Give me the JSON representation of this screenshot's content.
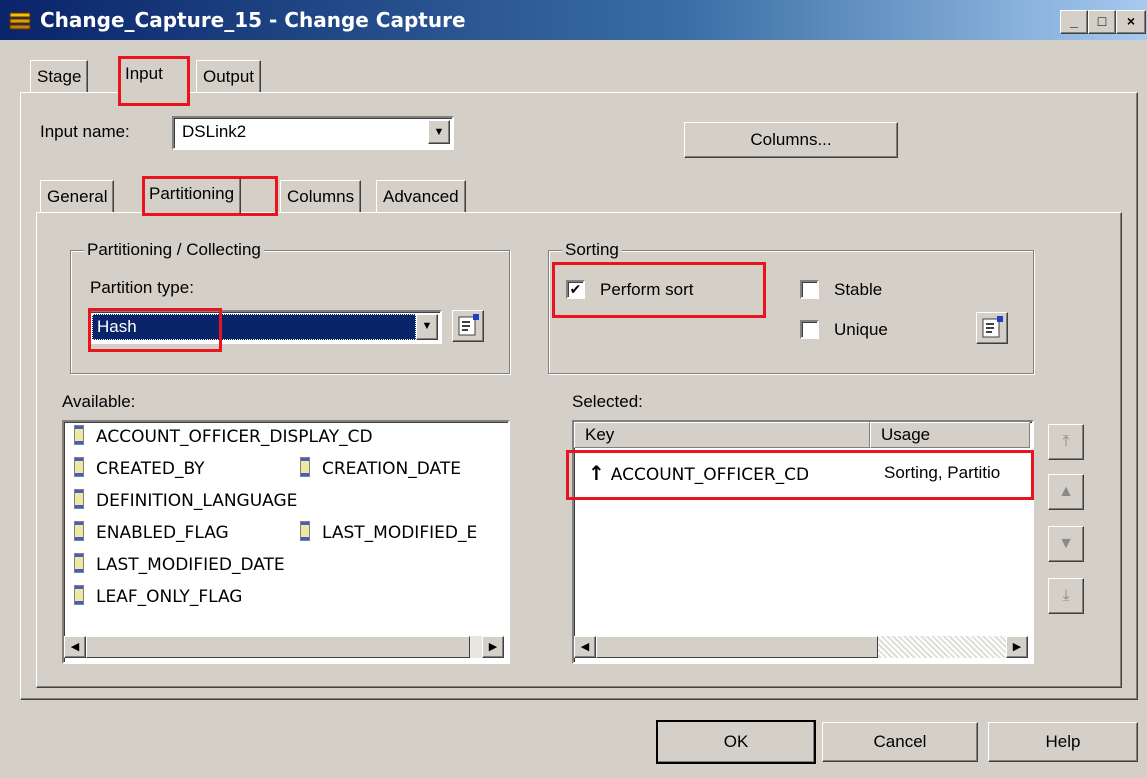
{
  "window": {
    "title": "Change_Capture_15 - Change Capture",
    "minimize": "_",
    "maximize": "□",
    "close": "×"
  },
  "top_tabs": [
    {
      "label": "Stage",
      "active": false
    },
    {
      "label": "Input",
      "active": true
    },
    {
      "label": "Output",
      "active": false
    }
  ],
  "input_name": {
    "label": "Input name:",
    "value": "DSLink2"
  },
  "columns_button": "Columns...",
  "sub_tabs": [
    {
      "label": "General",
      "active": false
    },
    {
      "label": "Partitioning",
      "active": true
    },
    {
      "label": "Columns",
      "active": false
    },
    {
      "label": "Advanced",
      "active": false
    }
  ],
  "partitioning": {
    "group_title": "Partitioning / Collecting",
    "type_label": "Partition type:",
    "type_value": "Hash"
  },
  "sorting": {
    "group_title": "Sorting",
    "perform_sort": {
      "label": "Perform sort",
      "checked": true
    },
    "stable": {
      "label": "Stable",
      "checked": false
    },
    "unique": {
      "label": "Unique",
      "checked": false
    }
  },
  "available": {
    "label": "Available:",
    "items": [
      "ACCOUNT_OFFICER_DISPLAY_CD",
      "CREATED_BY",
      "CREATION_DATE",
      "DEFINITION_LANGUAGE",
      "ENABLED_FLAG",
      "LAST_MODIFIED_E",
      "LAST_MODIFIED_DATE",
      "LEAF_ONLY_FLAG"
    ]
  },
  "selected": {
    "label": "Selected:",
    "headers": {
      "key": "Key",
      "usage": "Usage"
    },
    "rows": [
      {
        "key": "ACCOUNT_OFFICER_CD",
        "usage": "Sorting, Partitio",
        "sort_arrow": "↑"
      }
    ]
  },
  "buttons": {
    "ok": "OK",
    "cancel": "Cancel",
    "help": "Help"
  },
  "icons": {
    "scroll_left": "◀",
    "scroll_right": "▶",
    "dropdown": "▼",
    "move_top": "⤒",
    "move_up": "▲",
    "move_down": "▼",
    "move_bottom": "⤓",
    "check": "✔"
  }
}
